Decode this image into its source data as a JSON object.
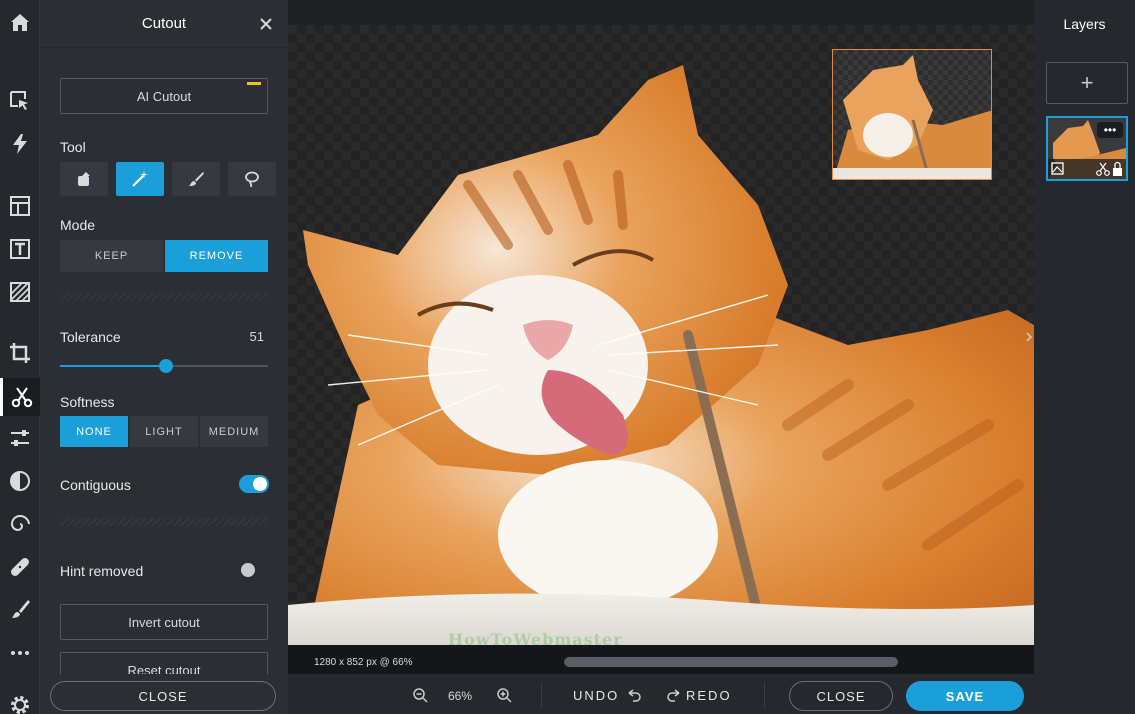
{
  "panel": {
    "title": "Cutout",
    "ai_cutout_label": "AI Cutout",
    "tool_label": "Tool",
    "tools": [
      "stamp-tool",
      "magic-wand-tool",
      "brush-tool",
      "lasso-tool"
    ],
    "active_tool": "magic-wand-tool",
    "mode_label": "Mode",
    "mode_options": [
      "KEEP",
      "REMOVE"
    ],
    "mode_selected": "REMOVE",
    "tolerance_label": "Tolerance",
    "tolerance_value": "51",
    "tolerance_fraction": 0.51,
    "softness_label": "Softness",
    "softness_options": [
      "NONE",
      "LIGHT",
      "MEDIUM"
    ],
    "softness_selected": "NONE",
    "contiguous_label": "Contiguous",
    "contiguous_on": true,
    "hint_removed_label": "Hint removed",
    "hint_removed_on": false,
    "invert_label": "Invert cutout",
    "reset_label": "Reset cutout",
    "close_label": "CLOSE"
  },
  "toolbar_icons": [
    "home-icon",
    "select-icon",
    "flash-icon",
    "layout-icon",
    "text-icon",
    "texture-icon",
    "crop-icon",
    "cutout-icon",
    "adjust-icon",
    "filter-icon",
    "spiral-icon",
    "bandage-icon",
    "brush-icon",
    "more-icon",
    "settings-icon"
  ],
  "canvas": {
    "dimensions_text": "1280 x 852 px @ 66%",
    "watermark": "HowToWebmaster"
  },
  "layers": {
    "title": "Layers",
    "add_label": "+",
    "dots_label": "•••"
  },
  "bottombar": {
    "zoom_text": "66%",
    "undo_label": "UNDO",
    "redo_label": "REDO",
    "close_label": "CLOSE",
    "save_label": "SAVE"
  },
  "colors": {
    "accent": "#1a9fd8",
    "panel_bg": "#2b2f34",
    "toolbar_bg": "#25282c",
    "ai_badge": "#f2c31a",
    "preview_border": "#e88a3c"
  }
}
